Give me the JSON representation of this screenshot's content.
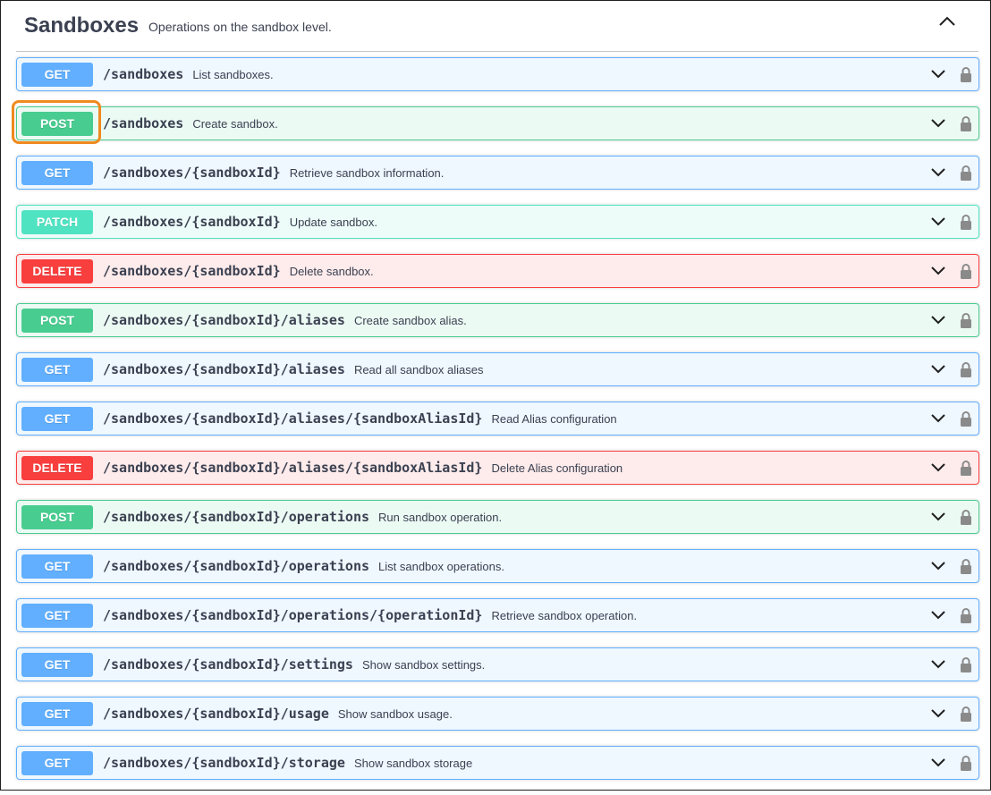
{
  "section": {
    "title": "Sandboxes",
    "description": "Operations on the sandbox level."
  },
  "icons": {
    "collapse": "chevron-up-icon",
    "expand": "chevron-down-icon",
    "lock": "lock-icon"
  },
  "colors": {
    "get": "#61affe",
    "post": "#49cc90",
    "patch": "#50e3c2",
    "delete": "#f93e3e",
    "highlight": "#ef8a1f"
  },
  "operations": [
    {
      "method": "GET",
      "path": "/sandboxes",
      "summary": "List sandboxes."
    },
    {
      "method": "POST",
      "path": "/sandboxes",
      "summary": "Create sandbox."
    },
    {
      "method": "GET",
      "path": "/sandboxes/{sandboxId}",
      "summary": "Retrieve sandbox information."
    },
    {
      "method": "PATCH",
      "path": "/sandboxes/{sandboxId}",
      "summary": "Update sandbox."
    },
    {
      "method": "DELETE",
      "path": "/sandboxes/{sandboxId}",
      "summary": "Delete sandbox."
    },
    {
      "method": "POST",
      "path": "/sandboxes/{sandboxId}/aliases",
      "summary": "Create sandbox alias."
    },
    {
      "method": "GET",
      "path": "/sandboxes/{sandboxId}/aliases",
      "summary": "Read all sandbox aliases"
    },
    {
      "method": "GET",
      "path": "/sandboxes/{sandboxId}/aliases/{sandboxAliasId}",
      "summary": "Read Alias configuration"
    },
    {
      "method": "DELETE",
      "path": "/sandboxes/{sandboxId}/aliases/{sandboxAliasId}",
      "summary": "Delete Alias configuration"
    },
    {
      "method": "POST",
      "path": "/sandboxes/{sandboxId}/operations",
      "summary": "Run sandbox operation."
    },
    {
      "method": "GET",
      "path": "/sandboxes/{sandboxId}/operations",
      "summary": "List sandbox operations."
    },
    {
      "method": "GET",
      "path": "/sandboxes/{sandboxId}/operations/{operationId}",
      "summary": "Retrieve sandbox operation."
    },
    {
      "method": "GET",
      "path": "/sandboxes/{sandboxId}/settings",
      "summary": "Show sandbox settings."
    },
    {
      "method": "GET",
      "path": "/sandboxes/{sandboxId}/usage",
      "summary": "Show sandbox usage."
    },
    {
      "method": "GET",
      "path": "/sandboxes/{sandboxId}/storage",
      "summary": "Show sandbox storage"
    }
  ]
}
